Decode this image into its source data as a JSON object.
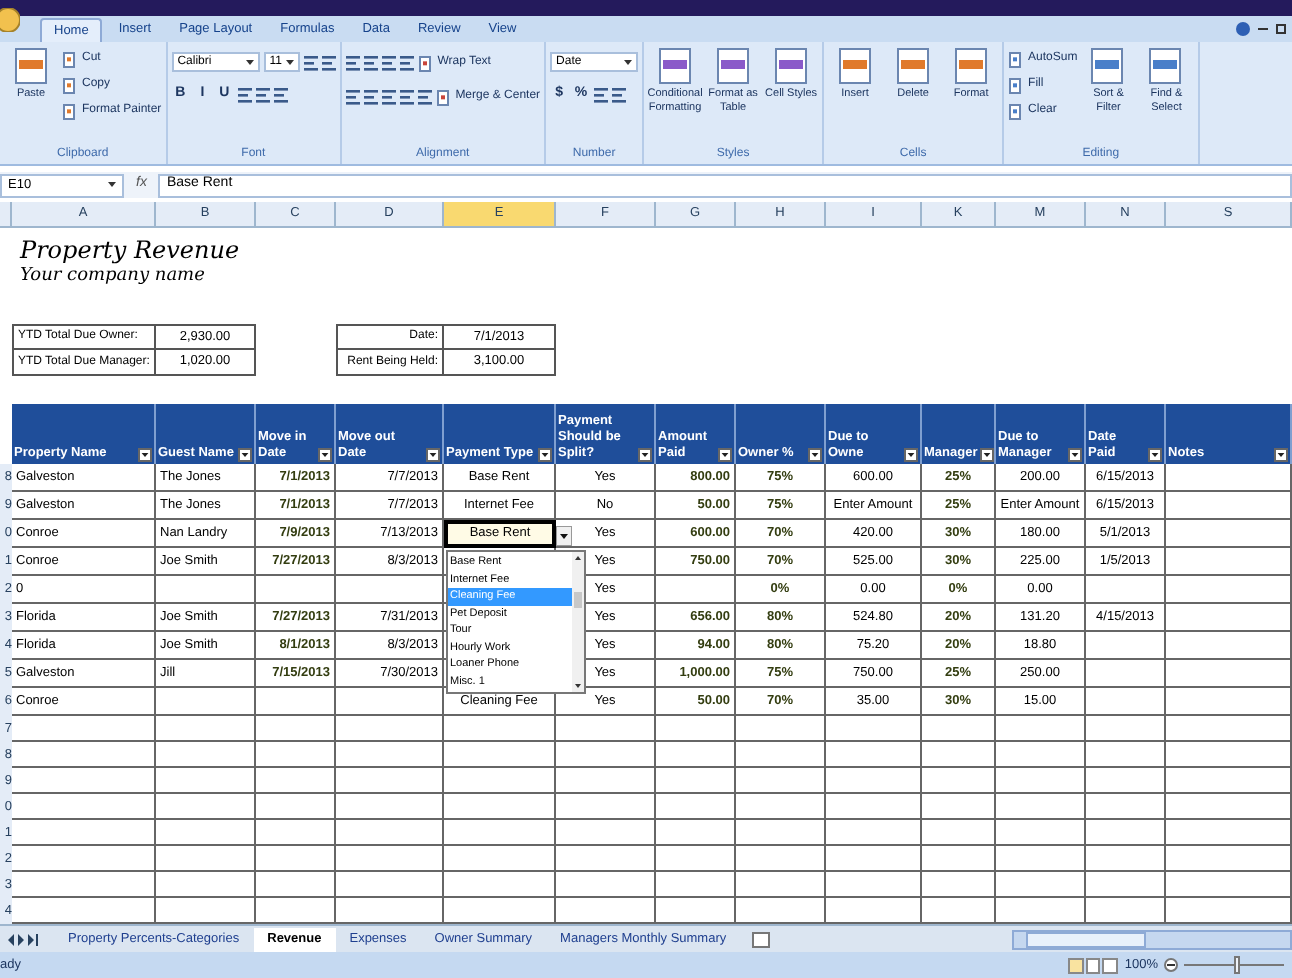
{
  "tabs": [
    {
      "label": "Home",
      "selected": true
    },
    {
      "label": "Insert",
      "selected": false
    },
    {
      "label": "Page Layout",
      "selected": false
    },
    {
      "label": "Formulas",
      "selected": false
    },
    {
      "label": "Data",
      "selected": false
    },
    {
      "label": "Review",
      "selected": false
    },
    {
      "label": "View",
      "selected": false
    }
  ],
  "ribbon": {
    "groups": [
      {
        "label": "Clipboard",
        "items": [
          {
            "kind": "large",
            "label": "Paste"
          },
          {
            "kind": "small",
            "label": "Cut"
          },
          {
            "kind": "small",
            "label": "Copy"
          },
          {
            "kind": "small",
            "label": "Format Painter"
          }
        ]
      },
      {
        "label": "Font",
        "lines": [
          [
            {
              "kind": "combo",
              "label": "Calibri"
            },
            {
              "kind": "combo",
              "label": "11"
            },
            {
              "kind": "icon"
            },
            {
              "kind": "icon"
            }
          ],
          [
            {
              "kind": "toggle",
              "label": "B"
            },
            {
              "kind": "toggle",
              "label": "I"
            },
            {
              "kind": "toggle",
              "label": "U"
            },
            {
              "kind": "icon"
            },
            {
              "kind": "icon"
            },
            {
              "kind": "icon"
            }
          ]
        ]
      },
      {
        "label": "Alignment",
        "lines": [
          [
            {
              "kind": "icon"
            },
            {
              "kind": "icon"
            },
            {
              "kind": "icon"
            },
            {
              "kind": "icon"
            },
            {
              "kind": "small",
              "label": "Wrap Text"
            }
          ],
          [
            {
              "kind": "icon"
            },
            {
              "kind": "icon"
            },
            {
              "kind": "icon"
            },
            {
              "kind": "icon"
            },
            {
              "kind": "icon"
            },
            {
              "kind": "small",
              "label": "Merge & Center"
            }
          ]
        ]
      },
      {
        "label": "Number",
        "lines": [
          [
            {
              "kind": "combo",
              "label": "Date"
            }
          ],
          [
            {
              "kind": "toggle",
              "label": "$"
            },
            {
              "kind": "toggle",
              "label": "%"
            },
            {
              "kind": "icon"
            },
            {
              "kind": "icon"
            }
          ]
        ]
      },
      {
        "label": "Styles",
        "items": [
          {
            "kind": "large",
            "label": "Conditional Formatting"
          },
          {
            "kind": "large",
            "label": "Format as Table"
          },
          {
            "kind": "large",
            "label": "Cell Styles"
          }
        ]
      },
      {
        "label": "Cells",
        "items": [
          {
            "kind": "large",
            "label": "Insert"
          },
          {
            "kind": "large",
            "label": "Delete"
          },
          {
            "kind": "large",
            "label": "Format"
          }
        ]
      },
      {
        "label": "Editing",
        "items": [
          {
            "kind": "small",
            "label": "AutoSum"
          },
          {
            "kind": "small",
            "label": "Fill"
          },
          {
            "kind": "small",
            "label": "Clear"
          },
          {
            "kind": "large",
            "label": "Sort & Filter"
          },
          {
            "kind": "large",
            "label": "Find & Select"
          }
        ]
      }
    ]
  },
  "formula_bar": {
    "name_box": "E10",
    "function_label": "fx",
    "value": "Base Rent"
  },
  "columns": [
    {
      "letter": "A",
      "selected": false
    },
    {
      "letter": "B",
      "selected": false
    },
    {
      "letter": "C",
      "selected": false
    },
    {
      "letter": "D",
      "selected": false
    },
    {
      "letter": "E",
      "selected": true
    },
    {
      "letter": "F",
      "selected": false
    },
    {
      "letter": "G",
      "selected": false
    },
    {
      "letter": "H",
      "selected": false
    },
    {
      "letter": "I",
      "selected": false
    },
    {
      "letter": "K",
      "selected": false
    },
    {
      "letter": "M",
      "selected": false
    },
    {
      "letter": "N",
      "selected": false
    },
    {
      "letter": "S",
      "selected": false
    }
  ],
  "title": "Property Revenue",
  "subtitle": "Your company name",
  "summary_left": [
    {
      "label": "YTD Total Due Owner:",
      "value": "2,930.00"
    },
    {
      "label": "YTD Total Due Manager:",
      "value": "1,020.00"
    }
  ],
  "summary_right": [
    {
      "label": "Date:",
      "value": "7/1/2013"
    },
    {
      "label": "Rent Being Held:",
      "value": "3,100.00"
    }
  ],
  "headers": [
    "Property Name",
    "Guest Name",
    "Move in Date",
    "Move out Date",
    "Payment Type",
    "Payment Should be Split?",
    "Amount Paid",
    "Owner %",
    "Due to Owne",
    "Manager",
    "Due to Manager",
    "Date Paid",
    "Notes"
  ],
  "rows": [
    {
      "row": "8",
      "editing": false,
      "cells": [
        "Galveston",
        "The Jones",
        "7/1/2013",
        "7/7/2013",
        "Base Rent",
        "Yes",
        "800.00",
        "75%",
        "600.00",
        "25%",
        "200.00",
        "6/15/2013",
        null
      ]
    },
    {
      "row": "9",
      "editing": false,
      "cells": [
        "Galveston",
        "The Jones",
        "7/1/2013",
        "7/7/2013",
        "Internet Fee",
        "No",
        "50.00",
        "75%",
        "Enter Amount",
        "25%",
        "Enter Amount",
        "6/15/2013",
        null
      ]
    },
    {
      "row": "0",
      "editing": true,
      "cells": [
        "Conroe",
        "Nan Landry",
        "7/9/2013",
        "7/13/2013",
        "Base Rent",
        "Yes",
        "600.00",
        "70%",
        "420.00",
        "30%",
        "180.00",
        "5/1/2013",
        null
      ]
    },
    {
      "row": "1",
      "editing": false,
      "cells": [
        "Conroe",
        "Joe Smith",
        "7/27/2013",
        "8/3/2013",
        null,
        "Yes",
        "750.00",
        "70%",
        "525.00",
        "30%",
        "225.00",
        "1/5/2013",
        null
      ]
    },
    {
      "row": "2",
      "editing": false,
      "cells": [
        "0",
        null,
        null,
        null,
        null,
        "Yes",
        null,
        "0%",
        "0.00",
        "0%",
        "0.00",
        null,
        null
      ]
    },
    {
      "row": "3",
      "editing": false,
      "cells": [
        "Florida",
        "Joe Smith",
        "7/27/2013",
        "7/31/2013",
        null,
        "Yes",
        "656.00",
        "80%",
        "524.80",
        "20%",
        "131.20",
        "4/15/2013",
        null
      ]
    },
    {
      "row": "4",
      "editing": false,
      "cells": [
        "Florida",
        "Joe Smith",
        "8/1/2013",
        "8/3/2013",
        null,
        "Yes",
        "94.00",
        "80%",
        "75.20",
        "20%",
        "18.80",
        null,
        null
      ]
    },
    {
      "row": "5",
      "editing": false,
      "cells": [
        "Galveston",
        "Jill",
        "7/15/2013",
        "7/30/2013",
        null,
        "Yes",
        "1,000.00",
        "75%",
        "750.00",
        "25%",
        "250.00",
        null,
        null
      ]
    },
    {
      "row": "6",
      "editing": false,
      "cells": [
        "Conroe",
        null,
        null,
        null,
        "Cleaning Fee",
        "Yes",
        "50.00",
        "70%",
        "35.00",
        "30%",
        "15.00",
        null,
        null
      ]
    }
  ],
  "blank_rows": [
    "7",
    "8",
    "9",
    "0",
    "1",
    "2",
    "3",
    "4"
  ],
  "validation_list": [
    {
      "label": "Base Rent",
      "selected": false
    },
    {
      "label": "Internet Fee",
      "selected": false
    },
    {
      "label": "Cleaning Fee",
      "selected": true
    },
    {
      "label": "Pet Deposit",
      "selected": false
    },
    {
      "label": "Tour",
      "selected": false
    },
    {
      "label": "Hourly Work",
      "selected": false
    },
    {
      "label": "Loaner Phone",
      "selected": false
    },
    {
      "label": "Misc. 1",
      "selected": false
    }
  ],
  "sheet_tabs": [
    {
      "label": "Property Percents-Categories",
      "selected": false
    },
    {
      "label": "Revenue",
      "selected": true
    },
    {
      "label": "Expenses",
      "selected": false
    },
    {
      "label": "Owner Summary",
      "selected": false
    },
    {
      "label": "Managers Monthly Summary",
      "selected": false
    }
  ],
  "status_bar": {
    "text": "ady",
    "zoom": {
      "text": "100%",
      "level": 0.5
    }
  }
}
